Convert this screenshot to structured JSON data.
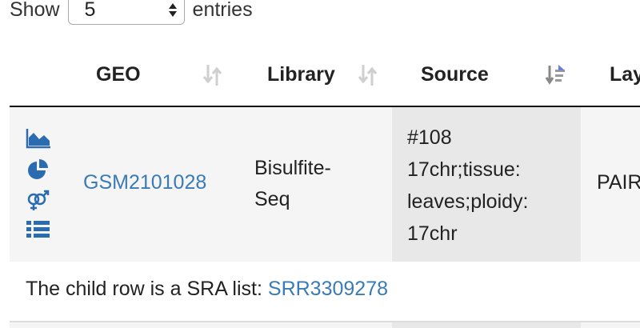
{
  "length_control": {
    "prefix": "Show",
    "value": "5",
    "suffix": "entries"
  },
  "columns": [
    {
      "label": "GEO",
      "sort": "none"
    },
    {
      "label": "Library",
      "sort": "none"
    },
    {
      "label": "Source",
      "sort": "descending"
    },
    {
      "label": "Lay"
    }
  ],
  "row": {
    "icons": [
      "area-chart-icon",
      "pie-chart-icon",
      "gender-icon",
      "list-icon"
    ],
    "geo": "GSM2101028",
    "library_lines": [
      "Bisulfite-",
      "Seq"
    ],
    "source_lines": [
      "#108",
      "17chr;tissue:",
      "leaves;ploidy:",
      "17chr"
    ],
    "layout": "PAIR"
  },
  "child_row": {
    "text": "The child row is a SRA list: ",
    "link": "SRR3309278"
  },
  "colors": {
    "link": "#3a7bb5",
    "row_bg": "#f5f5f5",
    "sorted_col_bg": "#e8e8e8"
  }
}
